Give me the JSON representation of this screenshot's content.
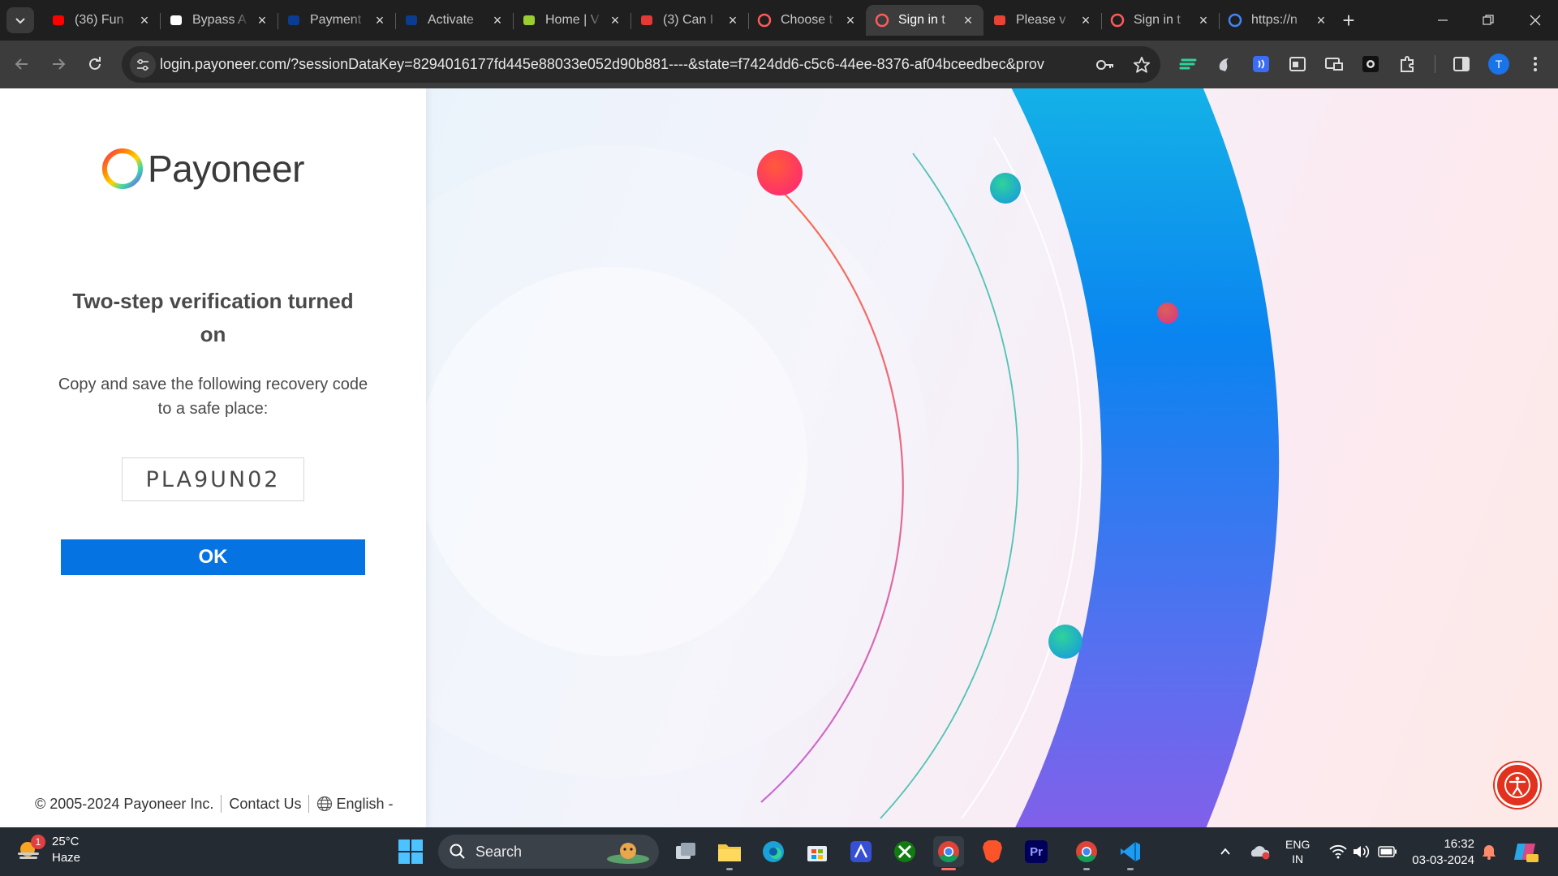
{
  "browser": {
    "tabs": [
      {
        "title": "(36) Fun",
        "favicon": "youtube-icon",
        "color": "#ff0000"
      },
      {
        "title": "Bypass A",
        "favicon": "b-letter-icon",
        "color": "#ffffff"
      },
      {
        "title": "Payment",
        "favicon": "paypal-icon",
        "color": "#0a3d91"
      },
      {
        "title": "Activate",
        "favicon": "paypal-icon",
        "color": "#0a3d91"
      },
      {
        "title": "Home | V",
        "favicon": "brand-icon",
        "color": "#9acd32"
      },
      {
        "title": "(3) Can I",
        "favicon": "g-letter-icon",
        "color": "#e53935"
      },
      {
        "title": "Choose t",
        "favicon": "payoneer-ring-icon",
        "color": "#ff5a5a"
      },
      {
        "title": "Sign in t",
        "favicon": "payoneer-ring-icon",
        "color": "#ff5a5a",
        "active": true
      },
      {
        "title": "Please v",
        "favicon": "gmail-icon",
        "color": "#ea4335"
      },
      {
        "title": "Sign in t",
        "favicon": "payoneer-ring-icon",
        "color": "#ff5a5a"
      },
      {
        "title": "https://n",
        "favicon": "google-icon",
        "color": "#4285f4"
      }
    ],
    "url": "login.payoneer.com/?sessionDataKey=8294016177fd445e88033e052d90b881----&state=f7424dd6-c5c6-44ee-8376-af04bceedbec&provider_id=i...",
    "profile_initial": "T"
  },
  "page": {
    "brand": "Payoneer",
    "heading": "Two-step verification turned on",
    "description": "Copy and save the following recovery code to a safe place:",
    "recovery_code": "PLA9UN02",
    "ok_label": "OK",
    "footer": {
      "copyright": "© 2005-2024 Payoneer Inc.",
      "contact": "Contact Us",
      "language": "English -"
    },
    "accent": "#0573e1"
  },
  "taskbar": {
    "weather": {
      "temp": "25°C",
      "condition": "Haze",
      "badge": "1"
    },
    "search_placeholder": "Search",
    "lang_line1": "ENG",
    "lang_line2": "IN",
    "time": "16:32",
    "date": "03-03-2024"
  }
}
